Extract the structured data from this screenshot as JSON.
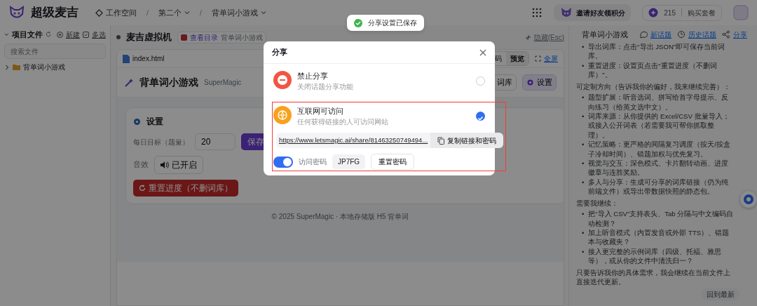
{
  "topbar": {
    "brand": "超级麦吉",
    "breadcrumbs": [
      {
        "label": "工作空间",
        "menu": false
      },
      {
        "separator": "/",
        "label": "第二个",
        "menu": true
      },
      {
        "separator": "/",
        "label": "背单词小游戏",
        "menu": true
      }
    ],
    "invite": "邀请好友领积分",
    "credits": "215",
    "buy": "购买套餐"
  },
  "sidebar": {
    "title": "项目文件",
    "actions": [
      "新建",
      "多选"
    ],
    "search": {
      "placeholder": "搜索文件"
    },
    "tree": [
      {
        "label": "背单词小游戏",
        "expanded": false
      }
    ]
  },
  "workspace": {
    "title": "麦吉虚拟机",
    "badge": {
      "link": "查看目录",
      "label": "背单词小游戏"
    },
    "hide": "隐藏(Esc)",
    "file_tab": "index.html",
    "views": [
      {
        "label": "码",
        "selected": false
      },
      {
        "label": "预览",
        "selected": true
      }
    ],
    "fullscreen": "全屏",
    "app": {
      "title": "背单词小游戏",
      "subtitle": "SuperMagic",
      "nav": [
        {
          "label": "词库",
          "selected": false
        },
        {
          "label": "设置",
          "selected": true
        }
      ],
      "settings": {
        "title": "设置",
        "goal_label": "每日目标（题量）",
        "goal_value": "20",
        "save": "保存",
        "sound_label": "音效",
        "sound_button": "已开启",
        "reset": "重置进度（不删词库）"
      },
      "footer": "© 2025 SuperMagic · 本地存储版 H5 背单词"
    }
  },
  "chat": {
    "title": "背单词小游戏",
    "actions": [
      "新话题",
      "历史话题",
      "分享"
    ],
    "blocks": [
      {
        "kind": "list",
        "bullet": "•",
        "items": [
          "导出词库：点击“导出 JSON”即可保存当前词库。",
          "重置进度：设置页点击“重置进度（不删词库）”。"
        ]
      },
      {
        "kind": "paragraph",
        "text": "可定制方向（告诉我你的偏好，我来继续完善）："
      },
      {
        "kind": "list",
        "bullet": "•",
        "items": [
          "题型扩展：听音选词、拼写给首字母提示、反向练习（给英文选中文）。",
          "词库来源：从你提供的 Excel/CSV 批量导入；或接入公开词表（若需要我可帮你抓取整理）。",
          "记忆策略：更严格的间隔复习调度（按天/按盒子冷却时间）、错题加权与优先复习。",
          "视觉与交互：深色模式、卡片翻转动画、进度徽章与连胜奖励。",
          "多人与分享：生成可分享的词库链接（仍为纯前端文件）或导出带数据快照的静态包。"
        ]
      },
      {
        "kind": "paragraph",
        "text": "需要我继续："
      },
      {
        "kind": "list",
        "bullet": "•",
        "items": [
          "把“导入 CSV”支持表头、Tab 分隔与中文编码自动检测？",
          "加上听音模式（内置发音或外部 TTS）、错题本与收藏夹？",
          "接入更完整的示例词库（四级、托福、雅思等），或从你的文件中清洗归一？"
        ]
      },
      {
        "kind": "paragraph",
        "text": "只要告诉我你的具体需求，我会继续在当前文件上直接迭代更新。"
      }
    ],
    "latest": "回到最新"
  },
  "toast": {
    "text": "分享设置已保存"
  },
  "dialog": {
    "title": "分享",
    "options": [
      {
        "kind": "blocked",
        "title": "禁止分享",
        "subtitle": "关闭话题分享功能",
        "selected": false
      },
      {
        "kind": "public",
        "title": "互联网可访问",
        "subtitle": "任何获得链接的人可访问网站",
        "selected": true
      }
    ],
    "link": "https://www.letsmagic.ai/share/81463250749494...",
    "copy": "复制链接和密码",
    "password": {
      "on": true,
      "label": "访问密码",
      "code": "JP7FG",
      "reset": "重置密码"
    }
  }
}
